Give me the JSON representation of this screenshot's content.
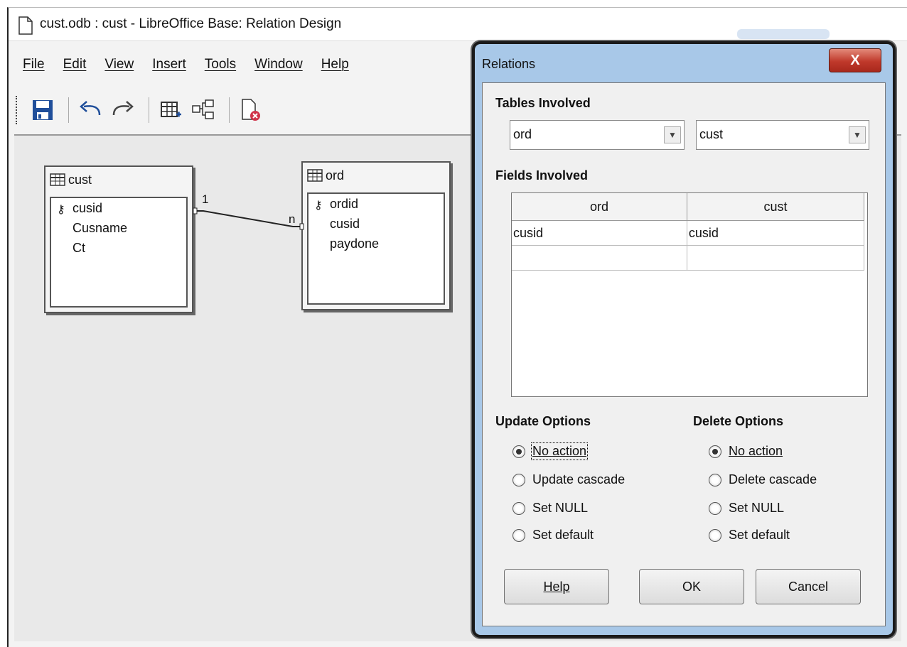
{
  "window": {
    "title": "cust.odb : cust - LibreOffice Base: Relation Design"
  },
  "menu": [
    {
      "label": "File"
    },
    {
      "label": "Edit"
    },
    {
      "label": "View"
    },
    {
      "label": "Insert"
    },
    {
      "label": "Tools"
    },
    {
      "label": "Window"
    },
    {
      "label": "Help"
    }
  ],
  "toolbar": {
    "icons": [
      "save-icon",
      "undo-icon",
      "redo-icon",
      "add-table-icon",
      "new-relation-icon",
      "delete-icon"
    ]
  },
  "tables": {
    "cust": {
      "name": "cust",
      "fields": [
        "cusid",
        "Cusname",
        "Ct"
      ]
    },
    "ord": {
      "name": "ord",
      "fields": [
        "ordid",
        "cusid",
        "paydone"
      ]
    }
  },
  "relation": {
    "one_label": "1",
    "many_label": "n"
  },
  "dialog": {
    "title": "Relations",
    "close_label": "X",
    "tables_involved_label": "Tables Involved",
    "table_left": "ord",
    "table_right": "cust",
    "fields_involved_label": "Fields Involved",
    "grid_headers": [
      "ord",
      "cust"
    ],
    "grid_rows": [
      [
        "cusid",
        "cusid"
      ],
      [
        "",
        ""
      ]
    ],
    "update_options": {
      "label": "Update Options",
      "options": [
        "No action",
        "Update cascade",
        "Set NULL",
        "Set default"
      ],
      "selected": "No action"
    },
    "delete_options": {
      "label": "Delete Options",
      "options": [
        "No action",
        "Delete cascade",
        "Set NULL",
        "Set default"
      ],
      "selected": "No action"
    },
    "buttons": {
      "help": "Help",
      "ok": "OK",
      "cancel": "Cancel"
    }
  },
  "colors": {
    "dialog_frame": "#a8c8e8",
    "close_button": "#c0392b",
    "save_icon": "#1f4e9a"
  }
}
